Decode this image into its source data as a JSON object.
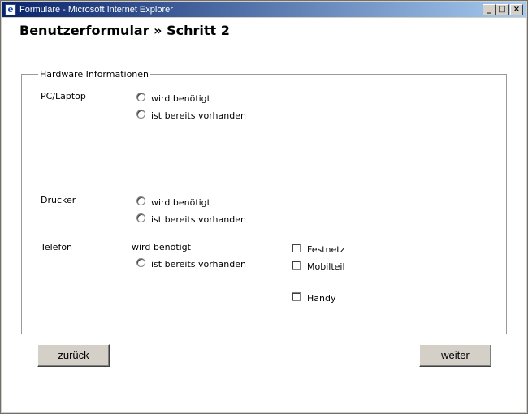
{
  "window": {
    "title": "Formulare - Microsoft Internet Explorer",
    "icon": "ie-icon",
    "controls": {
      "minimize": "_",
      "maximize": "□",
      "close": "×"
    }
  },
  "page": {
    "title": "Benutzerformular » Schritt 2"
  },
  "fieldset": {
    "legend": "Hardware Informationen"
  },
  "groups": {
    "pc": {
      "label": "PC/Laptop",
      "options": [
        "wird benötigt",
        "ist bereits vorhanden"
      ]
    },
    "drucker": {
      "label": "Drucker",
      "options": [
        "wird benötigt",
        "ist bereits vorhanden"
      ]
    },
    "telefon": {
      "label": "Telefon",
      "options": [
        "wird benötigt",
        "ist bereits vorhanden"
      ],
      "types": [
        "Festnetz",
        "Mobilteil",
        "Handy"
      ]
    }
  },
  "buttons": {
    "back": "zurück",
    "next": "weiter"
  }
}
